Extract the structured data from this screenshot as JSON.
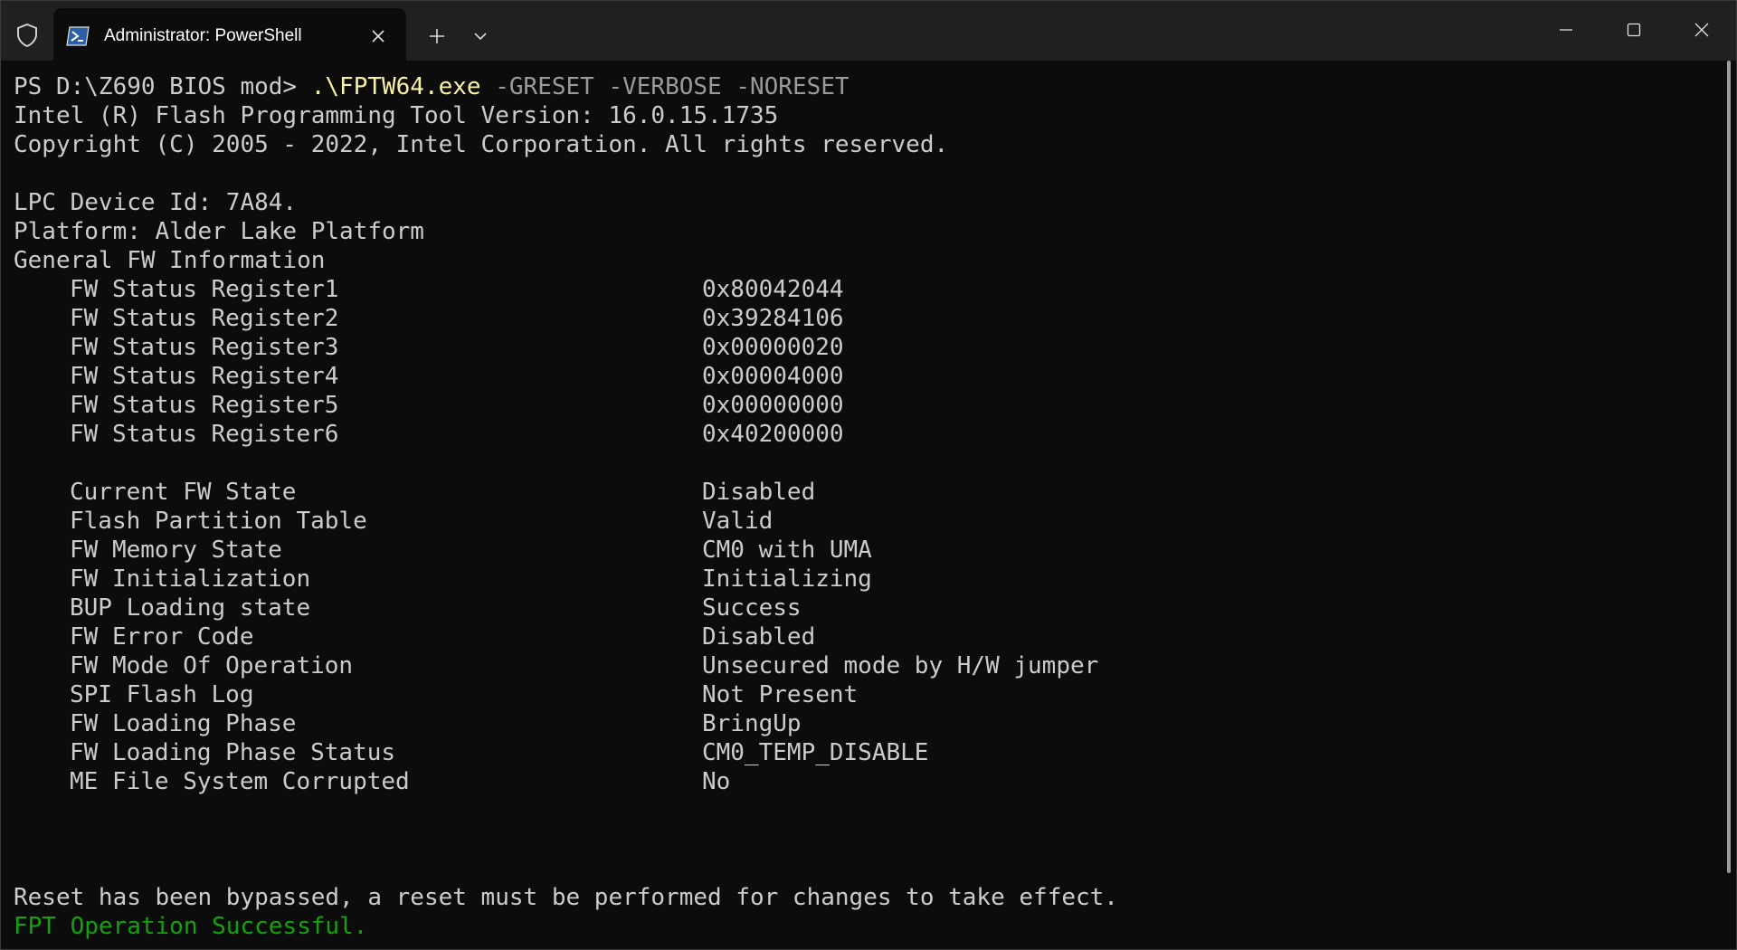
{
  "window": {
    "tab_title": "Administrator: PowerShell",
    "icons": {
      "shield": "shield-icon",
      "tab": "powershell-icon",
      "tab_close": "close-icon",
      "new_tab": "plus-icon",
      "dropdown": "chevron-down-icon",
      "minimize": "minimize-icon",
      "maximize": "maximize-icon",
      "close": "close-icon"
    }
  },
  "terminal": {
    "prompt": "PS D:\\Z690 BIOS mod> ",
    "command_exe": ".\\FPTW64.exe",
    "command_args": " -GRESET -VERBOSE -NORESET",
    "header_lines": [
      "Intel (R) Flash Programming Tool Version: 16.0.15.1735",
      "Copyright (C) 2005 - 2022, Intel Corporation. All rights reserved."
    ],
    "device_lines": [
      "LPC Device Id: 7A84.",
      "Platform: Alder Lake Platform",
      "General FW Information"
    ],
    "status_registers": [
      {
        "label": "FW Status Register1",
        "value": "0x80042044"
      },
      {
        "label": "FW Status Register2",
        "value": "0x39284106"
      },
      {
        "label": "FW Status Register3",
        "value": "0x00000020"
      },
      {
        "label": "FW Status Register4",
        "value": "0x00004000"
      },
      {
        "label": "FW Status Register5",
        "value": "0x00000000"
      },
      {
        "label": "FW Status Register6",
        "value": "0x40200000"
      }
    ],
    "fw_state": [
      {
        "label": "Current FW State",
        "value": "Disabled"
      },
      {
        "label": "Flash Partition Table",
        "value": "Valid"
      },
      {
        "label": "FW Memory State",
        "value": "CM0 with UMA"
      },
      {
        "label": "FW Initialization",
        "value": "Initializing"
      },
      {
        "label": "BUP Loading state",
        "value": "Success"
      },
      {
        "label": "FW Error Code",
        "value": "Disabled"
      },
      {
        "label": "FW Mode Of Operation",
        "value": "Unsecured mode by H/W jumper"
      },
      {
        "label": "SPI Flash Log",
        "value": "Not Present"
      },
      {
        "label": "FW Loading Phase",
        "value": "BringUp"
      },
      {
        "label": "FW Loading Phase Status",
        "value": "CM0_TEMP_DISABLE"
      },
      {
        "label": "ME File System Corrupted",
        "value": "No"
      }
    ],
    "reset_message": "Reset has been bypassed, a reset must be performed for changes to take effect.",
    "success_message": "FPT Operation Successful."
  },
  "colors": {
    "background": "#0c0c0c",
    "titlebar": "#202020",
    "text": "#cccccc",
    "command_exe": "#f9f1a5",
    "command_args": "#9a9a9a",
    "success": "#13a10e"
  }
}
